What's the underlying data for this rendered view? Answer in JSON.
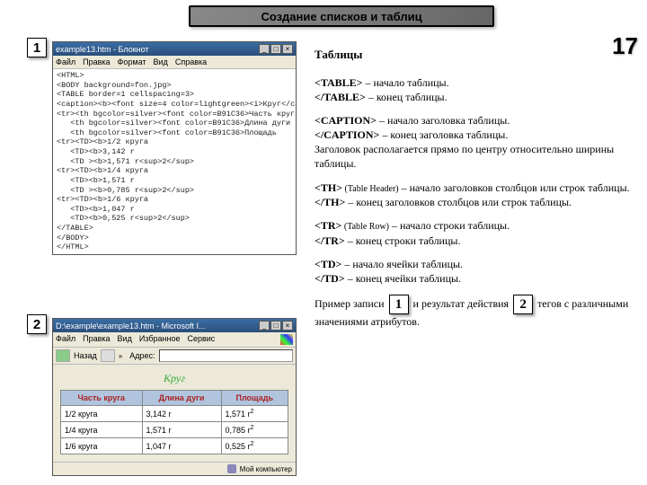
{
  "banner": "Создание списков и таблиц",
  "pageNumber": "17",
  "markers": {
    "m1": "1",
    "m2": "2"
  },
  "editor": {
    "title": "example13.htm - Блокнот",
    "menu": [
      "Файл",
      "Правка",
      "Формат",
      "Вид",
      "Справка"
    ],
    "code": "<HTML>\n<BODY background=fon.jpg>\n<TABLE border=1 cellspacing=3>\n<caption><b><font size=4 color=lightgreen><i>Круг</caption></i>\n<tr><th bgcolor=silver><font color=B91C36>Часть круга\n   <th bgcolor=silver><font color=B91C36>Длина дуги\n   <th bgcolor=silver><font color=B91C36>Площадь\n<tr><TD><b>1/2 круга\n   <TD><b>3,142 r\n   <TD ><b>1,571 r<sup>2</sup>\n<tr><TD><b>1/4 круга\n   <TD><b>1,571 r\n   <TD ><b>0,785 r<sup>2</sup>\n<tr><TD><b>1/6 круга\n   <TD><b>1,047 r\n   <TD><b>0,525 r<sup>2</sup>\n</TABLE>\n</BODY>\n</HTML>"
  },
  "browser": {
    "title": "D:\\example\\example13.htm - Microsoft I...",
    "menu": [
      "Файл",
      "Правка",
      "Вид",
      "Избранное",
      "Сервис"
    ],
    "addrLabel": "Адрес:",
    "backLabel": "Назад",
    "pageHeading": "Круг",
    "headers": [
      "Часть круга",
      "Длина дуги",
      "Площадь"
    ],
    "rows": [
      [
        "1/2 круга",
        "3,142 r",
        "1,571 r",
        "2"
      ],
      [
        "1/4 круга",
        "1,571 r",
        "0,785 r",
        "2"
      ],
      [
        "1/6 круга",
        "1,047 r",
        "0,525 r",
        "2"
      ]
    ],
    "status": "Мой компьютер"
  },
  "right": {
    "heading": "Таблицы",
    "p1a": "<TABLE>",
    "p1b": " – начало таблицы.",
    "p2a": "</TABLE>",
    "p2b": " – конец таблицы.",
    "p3a": "<CAPTION>",
    "p3b": " – начало заголовка таблицы.",
    "p4a": " </CAPTION>",
    "p4b": " – конец заголовка таблицы.",
    "p5": "Заголовок располагается прямо по центру относительно ширины таблицы.",
    "p6a": "<TH>",
    "p6n": " (Table Header)",
    "p6b": " – начало  заголовков столбцов или строк таблицы.",
    "p7a": "</TH>",
    "p7b": "  – конец заголовков столбцов или строк таблицы.",
    "p8a": "<TR>",
    "p8n": " (Table Row)",
    "p8b": " – начало  строки таблицы.",
    "p9a": "</TR>",
    "p9b": "  – конец  строки таблицы.",
    "p10a": "<TD>",
    "p10b": "  – начало  ячейки таблицы.",
    "p11a": "</TD>",
    "p11b": "  – конец  ячейки таблицы.",
    "p12a": "Пример записи ",
    "p12b": " и результат действия ",
    "p12c": " тегов с различными значениями атрибутов."
  }
}
